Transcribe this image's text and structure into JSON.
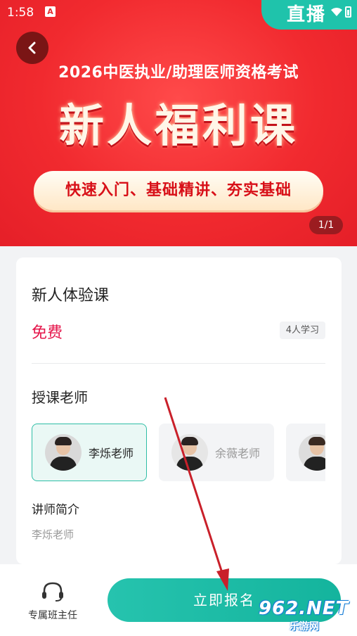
{
  "status_bar": {
    "time": "1:58",
    "a_icon": "A",
    "live_label": "直播"
  },
  "banner": {
    "subtitle": "2026中医执业/助理医师资格考试",
    "title": "新人福利课",
    "tag": "快速入门、基础精讲、夯实基础",
    "page_indicator": "1/1"
  },
  "course": {
    "title": "新人体验课",
    "price": "免费",
    "learners": "4人学习"
  },
  "teachers_section": {
    "title": "授课老师",
    "teachers": [
      {
        "name": "李烁老师",
        "selected": true
      },
      {
        "name": "余薇老师",
        "selected": false
      },
      {
        "name": "",
        "selected": false
      }
    ]
  },
  "intro": {
    "title": "讲师简介",
    "text": "李烁老师"
  },
  "bottom_bar": {
    "service_label": "专属班主任",
    "enroll_label": "立即报名"
  },
  "watermark": {
    "main": "962.NET",
    "sub": "乐游网"
  },
  "colors": {
    "banner_red": "#f12a2f",
    "accent_teal": "#1fbfa8",
    "price_red": "#e5154a"
  },
  "icons": [
    "back-arrow-icon",
    "headset-icon",
    "wifi-icon",
    "battery-icon"
  ]
}
